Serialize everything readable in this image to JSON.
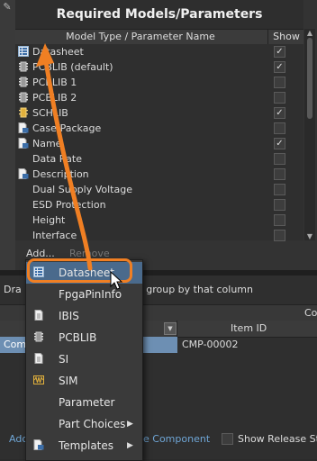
{
  "panel": {
    "title": "Required Models/Parameters",
    "col_name": "Model Type / Parameter Name",
    "col_show": "Show",
    "rows": [
      {
        "label": "Datasheet",
        "icon": "datasheet-icon",
        "checked": true
      },
      {
        "label": "PCBLIB (default)",
        "icon": "pcblib-icon",
        "checked": true
      },
      {
        "label": "PCBLIB 1",
        "icon": "pcblib-icon",
        "checked": false
      },
      {
        "label": "PCBLIB 2",
        "icon": "pcblib-icon",
        "checked": false
      },
      {
        "label": "SCHLIB",
        "icon": "schlib-icon",
        "checked": true
      },
      {
        "label": "Case/Package",
        "icon": "parameter-group-icon",
        "checked": false
      },
      {
        "label": "Name",
        "icon": "parameter-group-icon",
        "checked": true
      },
      {
        "label": "Data Rate",
        "icon": "",
        "checked": false
      },
      {
        "label": "Description",
        "icon": "parameter-group-icon",
        "checked": false
      },
      {
        "label": "Dual Supply Voltage",
        "icon": "",
        "checked": false
      },
      {
        "label": "ESD Protection",
        "icon": "",
        "checked": false
      },
      {
        "label": "Height",
        "icon": "",
        "checked": false
      },
      {
        "label": "Interface",
        "icon": "",
        "checked": false
      }
    ],
    "add_label": "Add...",
    "remove_label": "Remove"
  },
  "lower": {
    "drag_hint_left": "Dra",
    "drag_hint_right": "o group by that column",
    "group_header": "Co",
    "item_id_header": "Item ID",
    "row_component": "Comp",
    "row_item_id": "CMP-00002",
    "add_link": "Add",
    "component_link": "e Component",
    "show_release": "Show Release Sta"
  },
  "menu": {
    "items": [
      {
        "label": "Datasheet",
        "icon": "datasheet-icon",
        "submenu": false
      },
      {
        "label": "FpgaPinInfo",
        "icon": "",
        "submenu": false
      },
      {
        "label": "IBIS",
        "icon": "document-icon",
        "submenu": false
      },
      {
        "label": "PCBLIB",
        "icon": "chip-icon",
        "submenu": false
      },
      {
        "label": "SI",
        "icon": "document-icon",
        "submenu": false
      },
      {
        "label": "SIM",
        "icon": "waveform-icon",
        "submenu": false
      },
      {
        "label": "Parameter",
        "icon": "",
        "submenu": false
      },
      {
        "label": "Part Choices",
        "icon": "",
        "submenu": true
      },
      {
        "label": "Templates",
        "icon": "parameter-group-icon",
        "submenu": true
      }
    ]
  },
  "colors": {
    "accent_orange": "#f07f23",
    "selection_blue": "#6d8fb3",
    "link_blue": "#6fa6d6"
  }
}
